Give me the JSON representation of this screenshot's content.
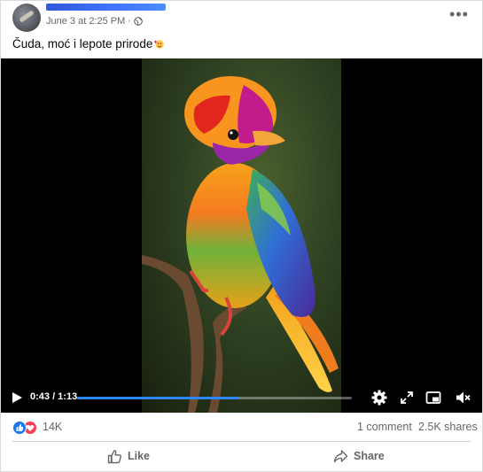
{
  "post": {
    "timestamp": "June 3 at 2:25 PM",
    "separator": "·",
    "caption": "Čuda, moć i lepote prirode"
  },
  "icons": {
    "audience": "globe-icon",
    "more": "more-options-icon",
    "caption_emoji": "heart-eyes-emoji",
    "reactions": [
      "like-reaction-icon",
      "love-reaction-icon"
    ]
  },
  "video": {
    "time": "0:43 / 1:13",
    "progress": 0.59,
    "progress_color": "#2d88ff"
  },
  "stats": {
    "reactions_count": "14K",
    "comments": "1 comment",
    "shares": "2.5K shares"
  },
  "actions": {
    "like_label": "Like",
    "share_label": "Share"
  }
}
